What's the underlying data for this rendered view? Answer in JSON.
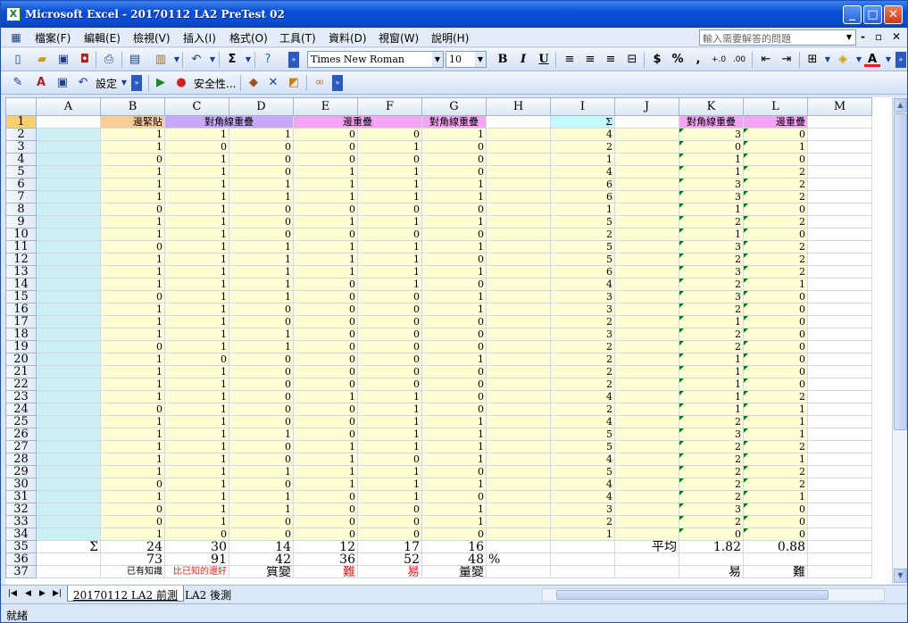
{
  "window": {
    "title": "Microsoft Excel - 20170112 LA2 PreTest 02",
    "app_icon": "excel-icon"
  },
  "menu": {
    "items": [
      "檔案(F)",
      "編輯(E)",
      "檢視(V)",
      "插入(I)",
      "格式(O)",
      "工具(T)",
      "資料(D)",
      "視窗(W)",
      "說明(H)"
    ],
    "help_placeholder": "輸入需要解答的問題"
  },
  "toolbar": {
    "font_name": "Times New Roman",
    "font_size": "10",
    "bold": "B",
    "italic": "I",
    "underline": "U",
    "currency": "$",
    "percent": "%",
    "comma": ",",
    "sigma": "Σ",
    "settings_label": "設定",
    "security_label": "安全性..."
  },
  "columns": [
    "A",
    "B",
    "C",
    "D",
    "E",
    "F",
    "G",
    "H",
    "I",
    "J",
    "K",
    "L",
    "M"
  ],
  "header_row": {
    "row": "1",
    "B": "邊緊貼",
    "CD": "對角線重疊",
    "EF": "邊重疊",
    "G": "對角線重疊",
    "I": "Σ",
    "K": "對角線重疊",
    "L": "邊重疊"
  },
  "rows": [
    {
      "n": "2",
      "b": "1",
      "c": "1",
      "d": "1",
      "e": "0",
      "f": "0",
      "g": "1",
      "i": "4",
      "k": "3",
      "l": "0"
    },
    {
      "n": "3",
      "b": "1",
      "c": "0",
      "d": "0",
      "e": "0",
      "f": "1",
      "g": "0",
      "i": "2",
      "k": "0",
      "l": "1"
    },
    {
      "n": "4",
      "b": "0",
      "c": "1",
      "d": "0",
      "e": "0",
      "f": "0",
      "g": "0",
      "i": "1",
      "k": "1",
      "l": "0"
    },
    {
      "n": "5",
      "b": "1",
      "c": "1",
      "d": "0",
      "e": "1",
      "f": "1",
      "g": "0",
      "i": "4",
      "k": "1",
      "l": "2"
    },
    {
      "n": "6",
      "b": "1",
      "c": "1",
      "d": "1",
      "e": "1",
      "f": "1",
      "g": "1",
      "i": "6",
      "k": "3",
      "l": "2"
    },
    {
      "n": "7",
      "b": "1",
      "c": "1",
      "d": "1",
      "e": "1",
      "f": "1",
      "g": "1",
      "i": "6",
      "k": "3",
      "l": "2"
    },
    {
      "n": "8",
      "b": "0",
      "c": "1",
      "d": "0",
      "e": "0",
      "f": "0",
      "g": "0",
      "i": "1",
      "k": "1",
      "l": "0"
    },
    {
      "n": "9",
      "b": "1",
      "c": "1",
      "d": "0",
      "e": "1",
      "f": "1",
      "g": "1",
      "i": "5",
      "k": "2",
      "l": "2"
    },
    {
      "n": "10",
      "b": "1",
      "c": "1",
      "d": "0",
      "e": "0",
      "f": "0",
      "g": "0",
      "i": "2",
      "k": "1",
      "l": "0"
    },
    {
      "n": "11",
      "b": "0",
      "c": "1",
      "d": "1",
      "e": "1",
      "f": "1",
      "g": "1",
      "i": "5",
      "k": "3",
      "l": "2"
    },
    {
      "n": "12",
      "b": "1",
      "c": "1",
      "d": "1",
      "e": "1",
      "f": "1",
      "g": "0",
      "i": "5",
      "k": "2",
      "l": "2"
    },
    {
      "n": "13",
      "b": "1",
      "c": "1",
      "d": "1",
      "e": "1",
      "f": "1",
      "g": "1",
      "i": "6",
      "k": "3",
      "l": "2"
    },
    {
      "n": "14",
      "b": "1",
      "c": "1",
      "d": "1",
      "e": "0",
      "f": "1",
      "g": "0",
      "i": "4",
      "k": "2",
      "l": "1"
    },
    {
      "n": "15",
      "b": "0",
      "c": "1",
      "d": "1",
      "e": "0",
      "f": "0",
      "g": "1",
      "i": "3",
      "k": "3",
      "l": "0"
    },
    {
      "n": "16",
      "b": "1",
      "c": "1",
      "d": "0",
      "e": "0",
      "f": "0",
      "g": "1",
      "i": "3",
      "k": "2",
      "l": "0"
    },
    {
      "n": "17",
      "b": "1",
      "c": "1",
      "d": "0",
      "e": "0",
      "f": "0",
      "g": "0",
      "i": "2",
      "k": "1",
      "l": "0"
    },
    {
      "n": "18",
      "b": "1",
      "c": "1",
      "d": "1",
      "e": "0",
      "f": "0",
      "g": "0",
      "i": "3",
      "k": "2",
      "l": "0"
    },
    {
      "n": "19",
      "b": "0",
      "c": "1",
      "d": "1",
      "e": "0",
      "f": "0",
      "g": "0",
      "i": "2",
      "k": "2",
      "l": "0"
    },
    {
      "n": "20",
      "b": "1",
      "c": "0",
      "d": "0",
      "e": "0",
      "f": "0",
      "g": "1",
      "i": "2",
      "k": "1",
      "l": "0"
    },
    {
      "n": "21",
      "b": "1",
      "c": "1",
      "d": "0",
      "e": "0",
      "f": "0",
      "g": "0",
      "i": "2",
      "k": "1",
      "l": "0"
    },
    {
      "n": "22",
      "b": "1",
      "c": "1",
      "d": "0",
      "e": "0",
      "f": "0",
      "g": "0",
      "i": "2",
      "k": "1",
      "l": "0"
    },
    {
      "n": "23",
      "b": "1",
      "c": "1",
      "d": "0",
      "e": "1",
      "f": "1",
      "g": "0",
      "i": "4",
      "k": "1",
      "l": "2"
    },
    {
      "n": "24",
      "b": "0",
      "c": "1",
      "d": "0",
      "e": "0",
      "f": "1",
      "g": "0",
      "i": "2",
      "k": "1",
      "l": "1"
    },
    {
      "n": "25",
      "b": "1",
      "c": "1",
      "d": "0",
      "e": "0",
      "f": "1",
      "g": "1",
      "i": "4",
      "k": "2",
      "l": "1"
    },
    {
      "n": "26",
      "b": "1",
      "c": "1",
      "d": "1",
      "e": "0",
      "f": "1",
      "g": "1",
      "i": "5",
      "k": "3",
      "l": "1"
    },
    {
      "n": "27",
      "b": "1",
      "c": "1",
      "d": "0",
      "e": "1",
      "f": "1",
      "g": "1",
      "i": "5",
      "k": "2",
      "l": "2"
    },
    {
      "n": "28",
      "b": "1",
      "c": "1",
      "d": "0",
      "e": "1",
      "f": "0",
      "g": "1",
      "i": "4",
      "k": "2",
      "l": "1"
    },
    {
      "n": "29",
      "b": "1",
      "c": "1",
      "d": "1",
      "e": "1",
      "f": "1",
      "g": "0",
      "i": "5",
      "k": "2",
      "l": "2"
    },
    {
      "n": "30",
      "b": "0",
      "c": "1",
      "d": "0",
      "e": "1",
      "f": "1",
      "g": "1",
      "i": "4",
      "k": "2",
      "l": "2"
    },
    {
      "n": "31",
      "b": "1",
      "c": "1",
      "d": "1",
      "e": "0",
      "f": "1",
      "g": "0",
      "i": "4",
      "k": "2",
      "l": "1"
    },
    {
      "n": "32",
      "b": "0",
      "c": "1",
      "d": "1",
      "e": "0",
      "f": "0",
      "g": "1",
      "i": "3",
      "k": "3",
      "l": "0"
    },
    {
      "n": "33",
      "b": "0",
      "c": "1",
      "d": "0",
      "e": "0",
      "f": "0",
      "g": "1",
      "i": "2",
      "k": "2",
      "l": "0"
    },
    {
      "n": "34",
      "b": "1",
      "c": "0",
      "d": "0",
      "e": "0",
      "f": "0",
      "g": "0",
      "i": "1",
      "k": "0",
      "l": "0"
    }
  ],
  "row35": {
    "n": "35",
    "a": "Σ",
    "b": "24",
    "c": "30",
    "d": "14",
    "e": "12",
    "f": "17",
    "g": "16",
    "j": "平均",
    "k": "1.82",
    "l": "0.88"
  },
  "row36": {
    "n": "36",
    "b": "73",
    "c": "91",
    "d": "42",
    "e": "36",
    "f": "52",
    "g": "48",
    "h": "%"
  },
  "row37": {
    "n": "37",
    "b": "已有知識",
    "c": "比已知的還好",
    "d": "質變",
    "e": "難",
    "f": "易",
    "g": "量變",
    "k": "易",
    "l": "難"
  },
  "sheets": [
    "20170112 LA2 前測",
    "LA2 後測"
  ],
  "status": "就緒",
  "colors": {
    "col_a_fill": "#cbeff4",
    "body_fill": "#fdfed4",
    "header_b": "#fbcb98",
    "header_cd": "#c8a9f8",
    "header_pink": "#f6a4f4",
    "header_i": "#c4fafd",
    "red_text": "#e02020"
  }
}
